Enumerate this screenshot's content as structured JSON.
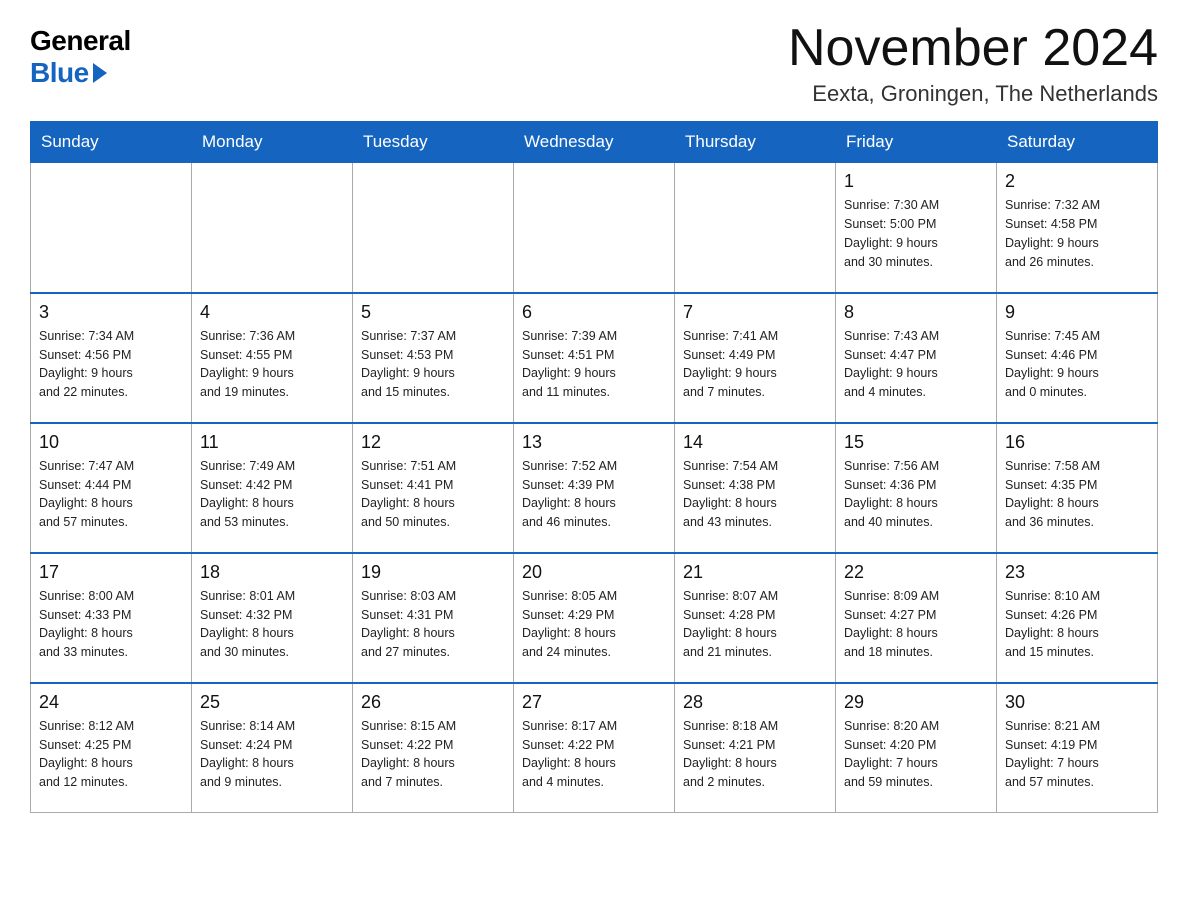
{
  "logo": {
    "general": "General",
    "blue": "Blue"
  },
  "title": "November 2024",
  "location": "Eexta, Groningen, The Netherlands",
  "weekdays": [
    "Sunday",
    "Monday",
    "Tuesday",
    "Wednesday",
    "Thursday",
    "Friday",
    "Saturday"
  ],
  "weeks": [
    [
      {
        "day": "",
        "info": ""
      },
      {
        "day": "",
        "info": ""
      },
      {
        "day": "",
        "info": ""
      },
      {
        "day": "",
        "info": ""
      },
      {
        "day": "",
        "info": ""
      },
      {
        "day": "1",
        "info": "Sunrise: 7:30 AM\nSunset: 5:00 PM\nDaylight: 9 hours\nand 30 minutes."
      },
      {
        "day": "2",
        "info": "Sunrise: 7:32 AM\nSunset: 4:58 PM\nDaylight: 9 hours\nand 26 minutes."
      }
    ],
    [
      {
        "day": "3",
        "info": "Sunrise: 7:34 AM\nSunset: 4:56 PM\nDaylight: 9 hours\nand 22 minutes."
      },
      {
        "day": "4",
        "info": "Sunrise: 7:36 AM\nSunset: 4:55 PM\nDaylight: 9 hours\nand 19 minutes."
      },
      {
        "day": "5",
        "info": "Sunrise: 7:37 AM\nSunset: 4:53 PM\nDaylight: 9 hours\nand 15 minutes."
      },
      {
        "day": "6",
        "info": "Sunrise: 7:39 AM\nSunset: 4:51 PM\nDaylight: 9 hours\nand 11 minutes."
      },
      {
        "day": "7",
        "info": "Sunrise: 7:41 AM\nSunset: 4:49 PM\nDaylight: 9 hours\nand 7 minutes."
      },
      {
        "day": "8",
        "info": "Sunrise: 7:43 AM\nSunset: 4:47 PM\nDaylight: 9 hours\nand 4 minutes."
      },
      {
        "day": "9",
        "info": "Sunrise: 7:45 AM\nSunset: 4:46 PM\nDaylight: 9 hours\nand 0 minutes."
      }
    ],
    [
      {
        "day": "10",
        "info": "Sunrise: 7:47 AM\nSunset: 4:44 PM\nDaylight: 8 hours\nand 57 minutes."
      },
      {
        "day": "11",
        "info": "Sunrise: 7:49 AM\nSunset: 4:42 PM\nDaylight: 8 hours\nand 53 minutes."
      },
      {
        "day": "12",
        "info": "Sunrise: 7:51 AM\nSunset: 4:41 PM\nDaylight: 8 hours\nand 50 minutes."
      },
      {
        "day": "13",
        "info": "Sunrise: 7:52 AM\nSunset: 4:39 PM\nDaylight: 8 hours\nand 46 minutes."
      },
      {
        "day": "14",
        "info": "Sunrise: 7:54 AM\nSunset: 4:38 PM\nDaylight: 8 hours\nand 43 minutes."
      },
      {
        "day": "15",
        "info": "Sunrise: 7:56 AM\nSunset: 4:36 PM\nDaylight: 8 hours\nand 40 minutes."
      },
      {
        "day": "16",
        "info": "Sunrise: 7:58 AM\nSunset: 4:35 PM\nDaylight: 8 hours\nand 36 minutes."
      }
    ],
    [
      {
        "day": "17",
        "info": "Sunrise: 8:00 AM\nSunset: 4:33 PM\nDaylight: 8 hours\nand 33 minutes."
      },
      {
        "day": "18",
        "info": "Sunrise: 8:01 AM\nSunset: 4:32 PM\nDaylight: 8 hours\nand 30 minutes."
      },
      {
        "day": "19",
        "info": "Sunrise: 8:03 AM\nSunset: 4:31 PM\nDaylight: 8 hours\nand 27 minutes."
      },
      {
        "day": "20",
        "info": "Sunrise: 8:05 AM\nSunset: 4:29 PM\nDaylight: 8 hours\nand 24 minutes."
      },
      {
        "day": "21",
        "info": "Sunrise: 8:07 AM\nSunset: 4:28 PM\nDaylight: 8 hours\nand 21 minutes."
      },
      {
        "day": "22",
        "info": "Sunrise: 8:09 AM\nSunset: 4:27 PM\nDaylight: 8 hours\nand 18 minutes."
      },
      {
        "day": "23",
        "info": "Sunrise: 8:10 AM\nSunset: 4:26 PM\nDaylight: 8 hours\nand 15 minutes."
      }
    ],
    [
      {
        "day": "24",
        "info": "Sunrise: 8:12 AM\nSunset: 4:25 PM\nDaylight: 8 hours\nand 12 minutes."
      },
      {
        "day": "25",
        "info": "Sunrise: 8:14 AM\nSunset: 4:24 PM\nDaylight: 8 hours\nand 9 minutes."
      },
      {
        "day": "26",
        "info": "Sunrise: 8:15 AM\nSunset: 4:22 PM\nDaylight: 8 hours\nand 7 minutes."
      },
      {
        "day": "27",
        "info": "Sunrise: 8:17 AM\nSunset: 4:22 PM\nDaylight: 8 hours\nand 4 minutes."
      },
      {
        "day": "28",
        "info": "Sunrise: 8:18 AM\nSunset: 4:21 PM\nDaylight: 8 hours\nand 2 minutes."
      },
      {
        "day": "29",
        "info": "Sunrise: 8:20 AM\nSunset: 4:20 PM\nDaylight: 7 hours\nand 59 minutes."
      },
      {
        "day": "30",
        "info": "Sunrise: 8:21 AM\nSunset: 4:19 PM\nDaylight: 7 hours\nand 57 minutes."
      }
    ]
  ]
}
